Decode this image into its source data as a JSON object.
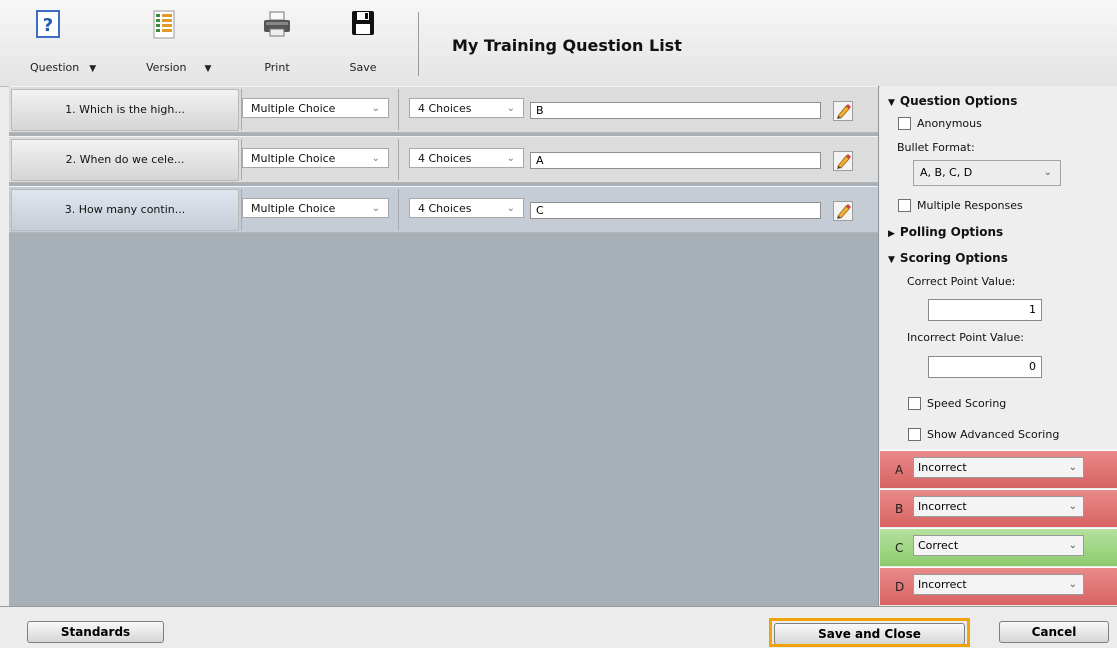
{
  "toolbar": {
    "question_label": "Question",
    "version_label": "Version",
    "print_label": "Print",
    "save_label": "Save",
    "title": "My Training Question List"
  },
  "questions": [
    {
      "name": "1. Which is the high...",
      "type": "Multiple Choice",
      "choices": "4 Choices",
      "answer": "B"
    },
    {
      "name": "2. When do we cele...",
      "type": "Multiple Choice",
      "choices": "4 Choices",
      "answer": "A"
    },
    {
      "name": "3. How many contin...",
      "type": "Multiple Choice",
      "choices": "4 Choices",
      "answer": "C"
    }
  ],
  "panel": {
    "question_options": "Question Options",
    "anonymous": "Anonymous",
    "bullet_format_label": "Bullet Format:",
    "bullet_format_value": "A, B, C, D",
    "multiple_responses": "Multiple Responses",
    "polling_options": "Polling Options",
    "scoring_options": "Scoring Options",
    "correct_point_label": "Correct Point Value:",
    "correct_point_value": "1",
    "incorrect_point_label": "Incorrect Point Value:",
    "incorrect_point_value": "0",
    "speed_scoring": "Speed Scoring",
    "show_advanced_scoring": "Show Advanced Scoring"
  },
  "answers": [
    {
      "letter": "A",
      "value": "Incorrect",
      "color": "#d86363"
    },
    {
      "letter": "B",
      "value": "Incorrect",
      "color": "#d86363"
    },
    {
      "letter": "C",
      "value": "Correct",
      "color": "#8ccc6c"
    },
    {
      "letter": "D",
      "value": "Incorrect",
      "color": "#d86363"
    }
  ],
  "footer": {
    "standards": "Standards",
    "save_and_close": "Save and Close",
    "cancel": "Cancel",
    "highlight_color": "#f0a30a"
  },
  "icons": {
    "question": "question-mark-icon",
    "version": "document-list-icon",
    "print": "printer-icon",
    "save": "floppy-disk-icon",
    "edit": "pencil-icon"
  }
}
